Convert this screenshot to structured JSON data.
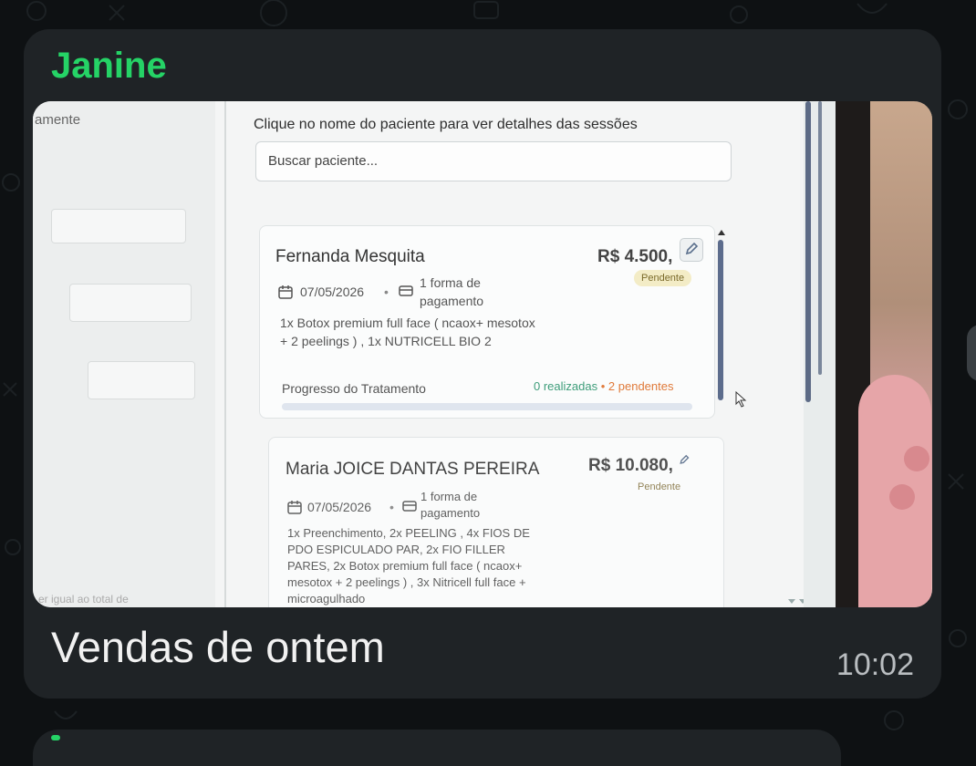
{
  "message": {
    "sender": "Janine",
    "caption": "Vendas de ontem",
    "time": "10:02"
  },
  "screen": {
    "left_label": "amente",
    "left_footer": "er igual ao total de",
    "hint": "Clique no nome do paciente para ver detalhes das sessões",
    "search_placeholder": "Buscar paciente...",
    "patients": [
      {
        "name": "Fernanda Mesquita",
        "price": "R$ 4.500,",
        "status": "Pendente",
        "date": "07/05/2026",
        "payment": "1 forma de pagamento",
        "items": "1x Botox premium full face ( ncaox+ mesotox + 2 peelings ) , 1x NUTRICELL BIO 2",
        "progress_label": "Progresso do Tratamento",
        "done": "0 realizadas",
        "pending": "2 pendentes",
        "progress": 0
      },
      {
        "name": "Maria JOICE DANTAS PEREIRA",
        "price": "R$ 10.080,",
        "status": "Pendente",
        "date": "07/05/2026",
        "payment": "1 forma de pagamento",
        "items": "1x Preenchimento, 2x PEELING , 4x FIOS DE PDO ESPICULADO PAR, 2x FIO FILLER PARES, 2x Botox premium full face ( ncaox+ mesotox + 2 peelings ) , 3x Nitricell full face + microagulhado"
      }
    ]
  },
  "colors": {
    "sender": "#25d366",
    "bubble": "#1f2326",
    "done": "#3e9d7a",
    "pending": "#e07a3a"
  }
}
